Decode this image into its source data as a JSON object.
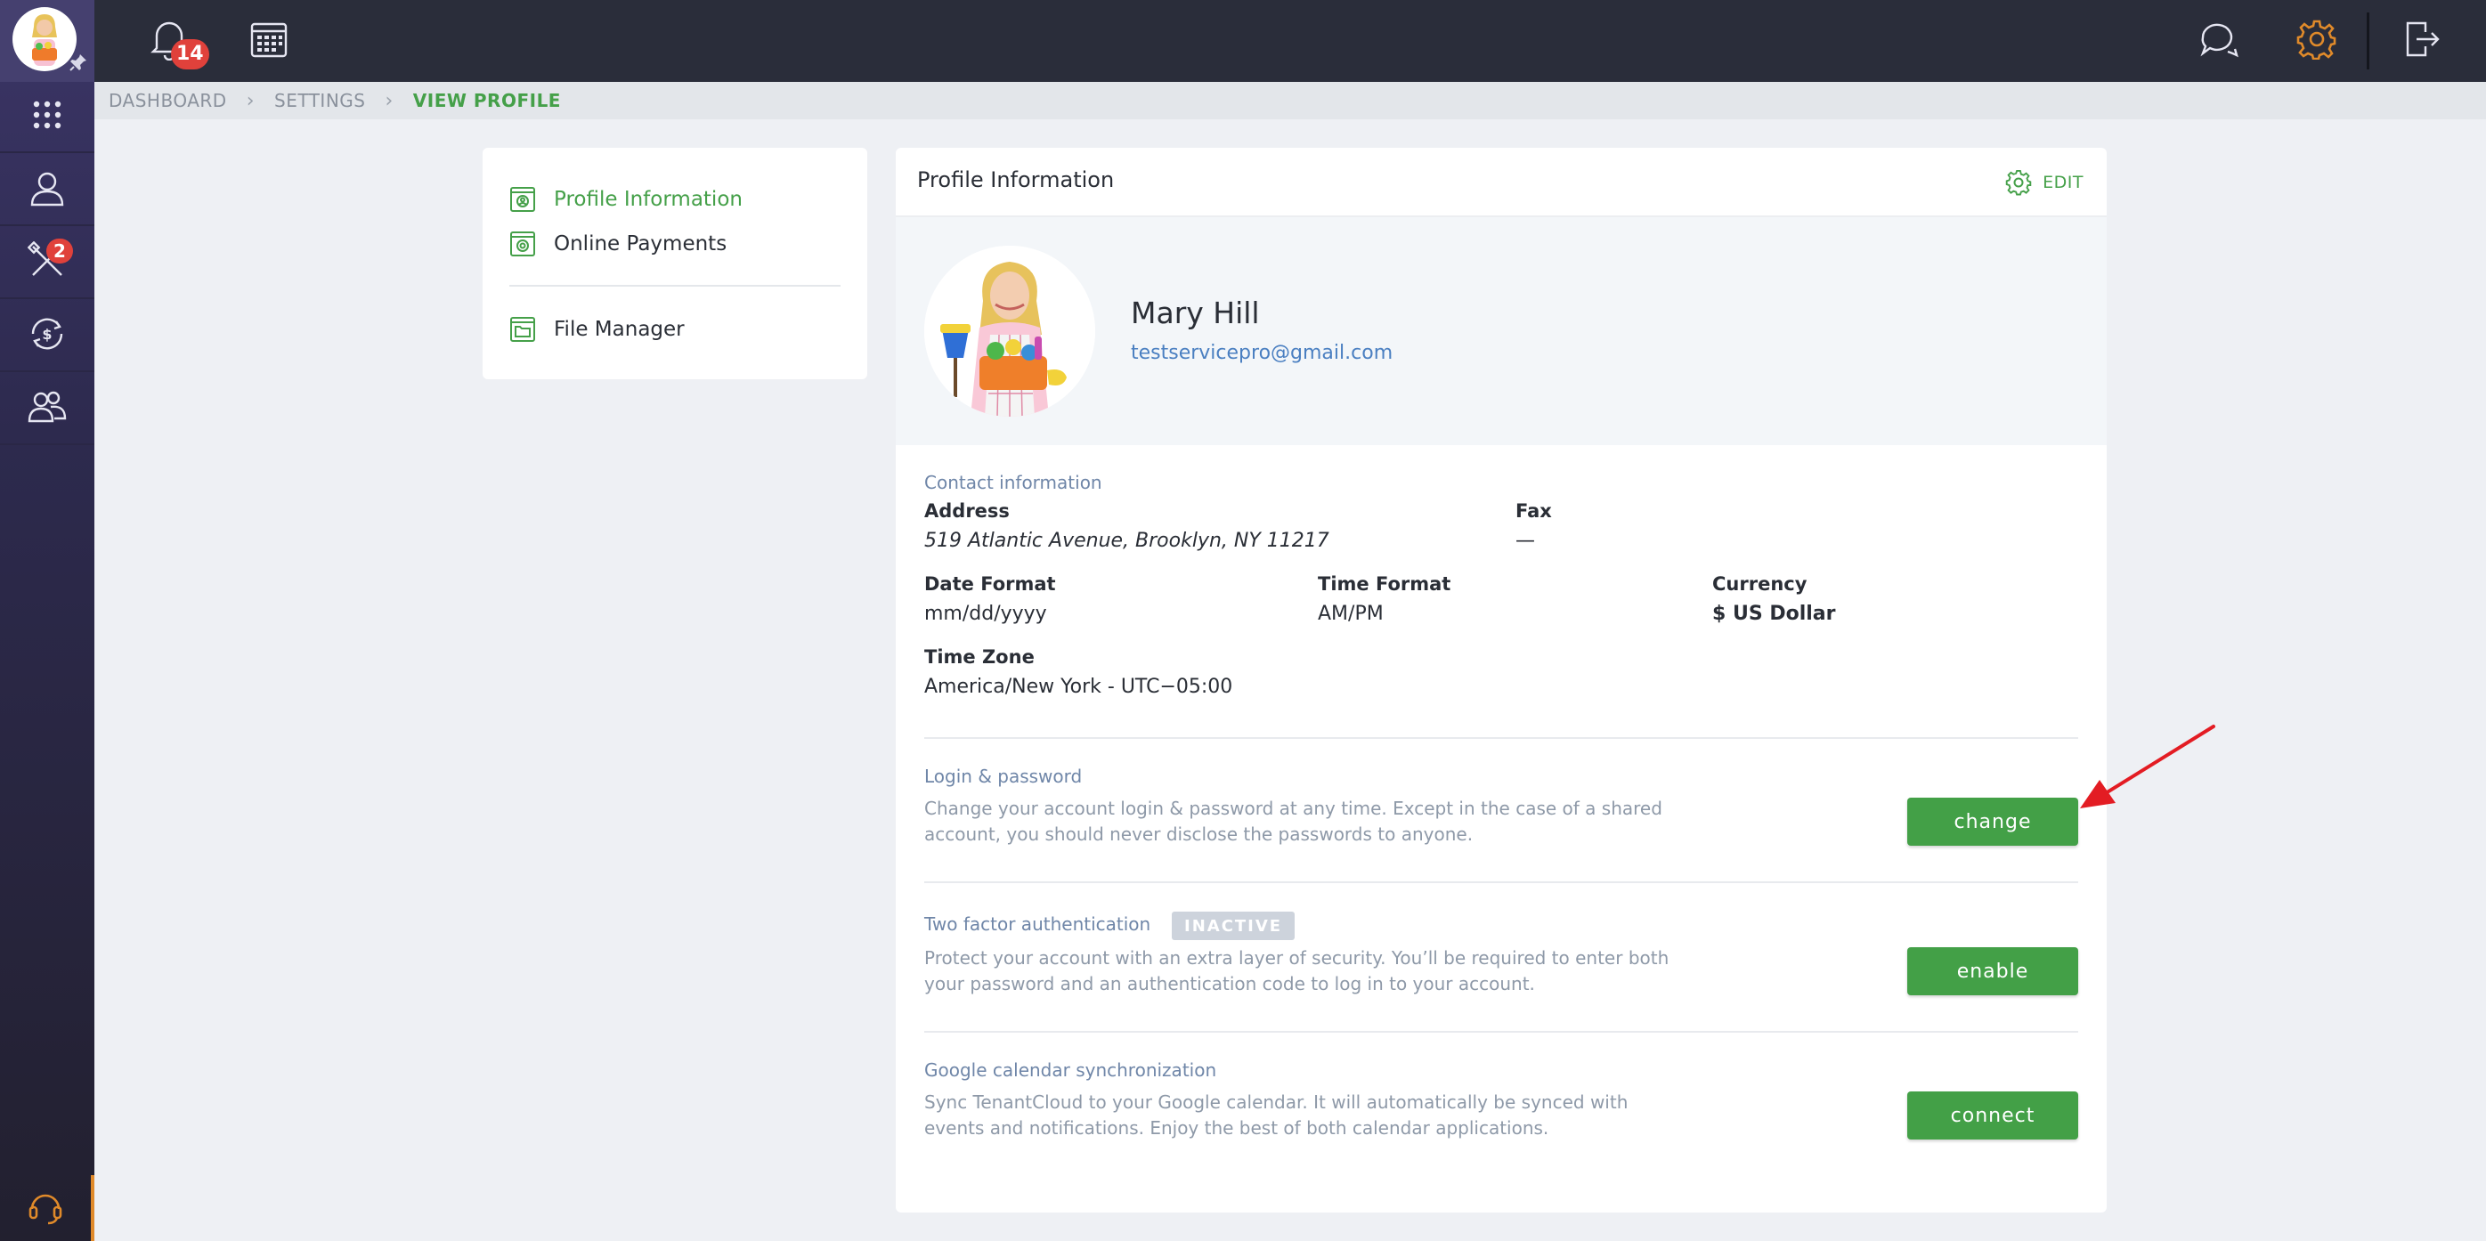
{
  "topbar": {
    "notifications_count": "14"
  },
  "sidebar": {
    "tools_badge": "2"
  },
  "breadcrumb": {
    "items": [
      "DASHBOARD",
      "SETTINGS",
      "VIEW PROFILE"
    ]
  },
  "nav": {
    "items": [
      {
        "label": "Profile Information"
      },
      {
        "label": "Online Payments"
      },
      {
        "label": "File Manager"
      }
    ]
  },
  "panel": {
    "title": "Profile Information",
    "edit_label": "EDIT"
  },
  "profile": {
    "name": "Mary Hill",
    "email": "testservicepro@gmail.com"
  },
  "contact": {
    "section_label": "Contact information",
    "address_label": "Address",
    "address_value": "519 Atlantic Avenue, Brooklyn, NY 11217",
    "fax_label": "Fax",
    "fax_value": "—",
    "date_format_label": "Date Format",
    "date_format_value": "mm/dd/yyyy",
    "time_format_label": "Time Format",
    "time_format_value": "AM/PM",
    "currency_label": "Currency",
    "currency_value": "$ US Dollar",
    "timezone_label": "Time Zone",
    "timezone_value": "America/New York - UTC−05:00"
  },
  "login": {
    "label": "Login & password",
    "line1": "Change your account login & password at any time. Except in the case of a shared",
    "line2": "account, you should never disclose the passwords to anyone.",
    "button": "change"
  },
  "twofactor": {
    "label": "Two factor authentication",
    "status": "INACTIVE",
    "line1": "Protect your account with an extra layer of security. You’ll be required to enter both",
    "line2": "your password and an authentication code to log in to your account.",
    "button": "enable"
  },
  "gcal": {
    "label": "Google calendar synchronization",
    "line1": "Sync TenantCloud to your Google calendar. It will automatically be synced with",
    "line2": "events and notifications. Enjoy the best of both calendar applications.",
    "button": "connect"
  },
  "colors": {
    "accent_green": "#43a047",
    "topbar": "#2a2d3a",
    "orange_gear": "#e08a2a",
    "annotation_arrow": "#e31c23"
  }
}
